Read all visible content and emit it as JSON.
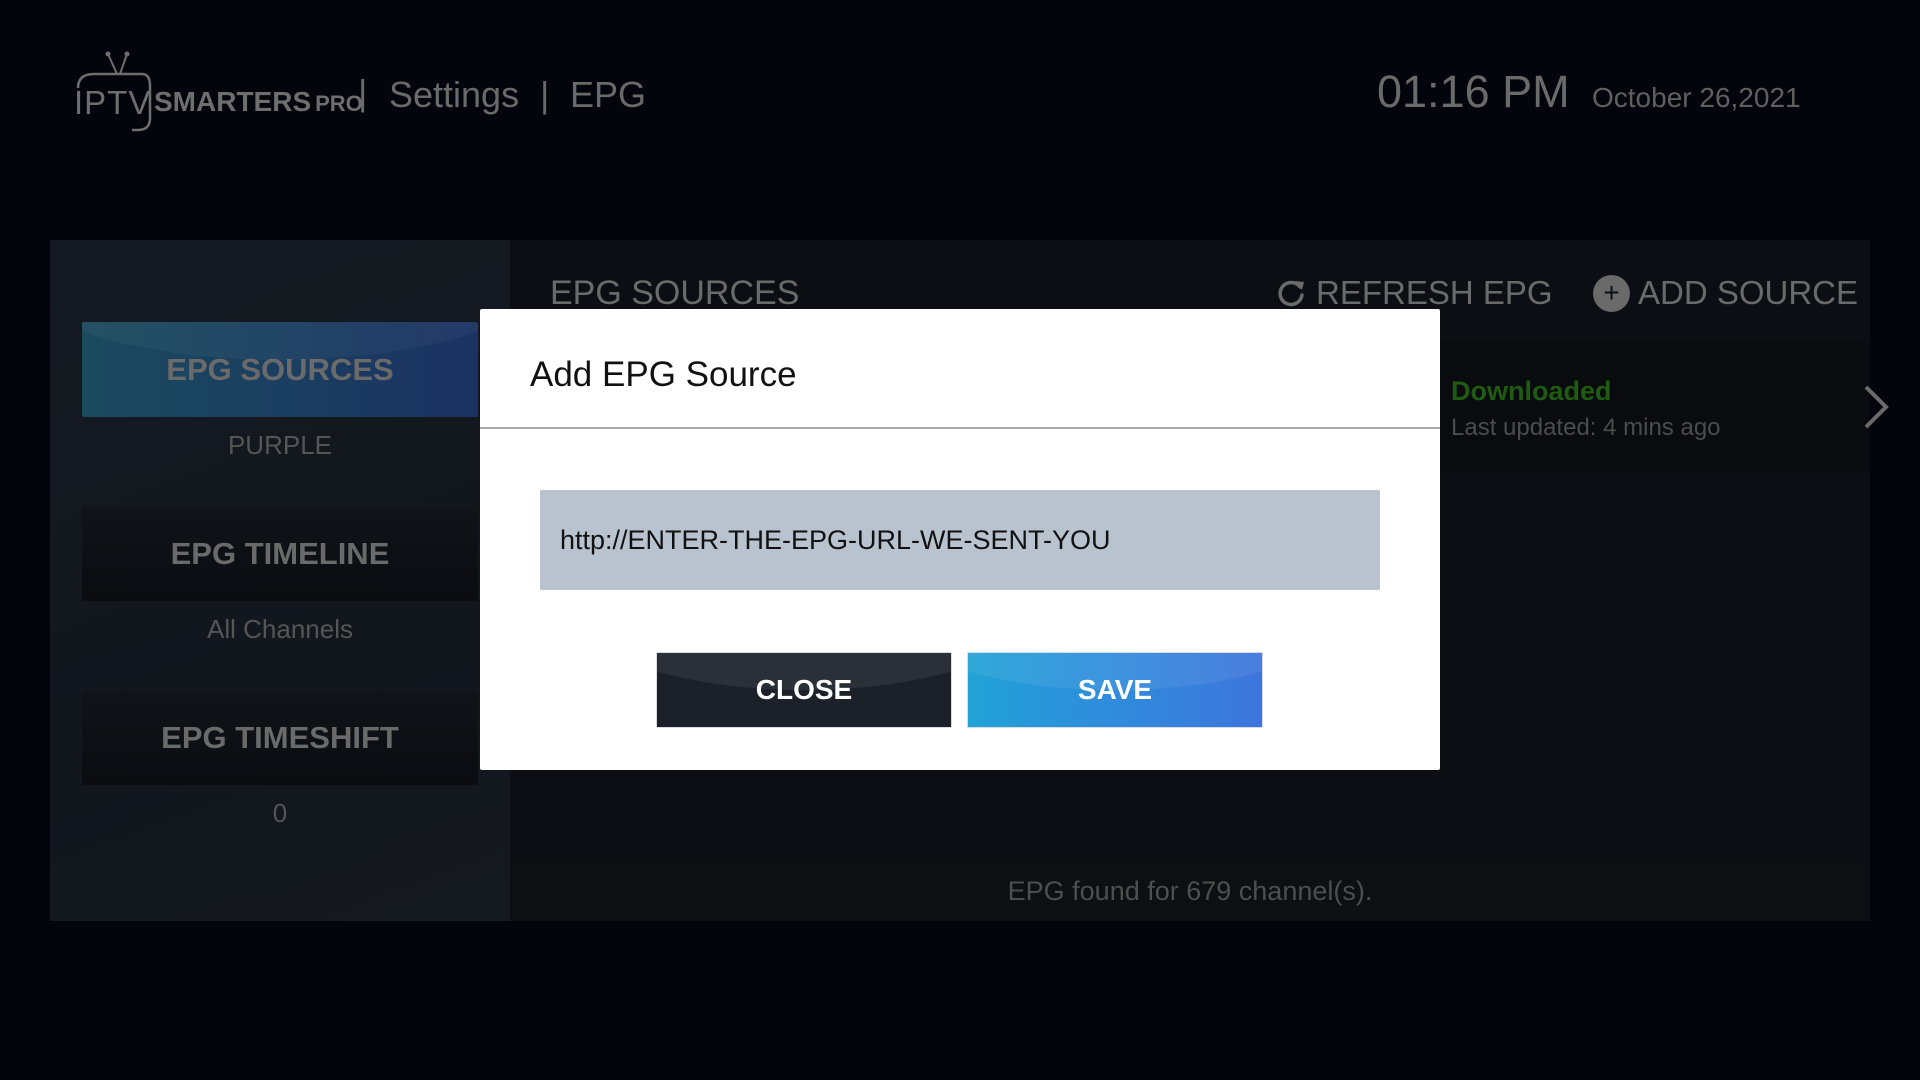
{
  "header": {
    "logo": {
      "iptv": "IPTV",
      "smarters": "SMARTERS",
      "pro": "PRO"
    },
    "breadcrumb": {
      "separator": "|",
      "section": "Settings",
      "page": "EPG"
    },
    "time": "01:16 PM",
    "date": "October 26,2021"
  },
  "sidebar": {
    "items": [
      {
        "label": "EPG SOURCES",
        "value": "PURPLE",
        "active": true
      },
      {
        "label": "EPG TIMELINE",
        "value": "All Channels",
        "active": false
      },
      {
        "label": "EPG TIMESHIFT",
        "value": "0",
        "active": false
      }
    ]
  },
  "main": {
    "title": "EPG SOURCES",
    "refresh_label": "REFRESH EPG",
    "add_source_label": "ADD SOURCE",
    "source": {
      "status": "Downloaded",
      "updated": "Last updated: 4 mins ago"
    },
    "footer": "EPG found for 679 channel(s)."
  },
  "dialog": {
    "title": "Add EPG Source",
    "input_value": "http://ENTER-THE-EPG-URL-WE-SENT-YOU",
    "close_label": "CLOSE",
    "save_label": "SAVE"
  },
  "colors": {
    "status_downloaded": "#1f5b10",
    "save_button": "#2f8ddc",
    "close_button": "#1b2029",
    "input_bg": "#b9c3cf"
  }
}
